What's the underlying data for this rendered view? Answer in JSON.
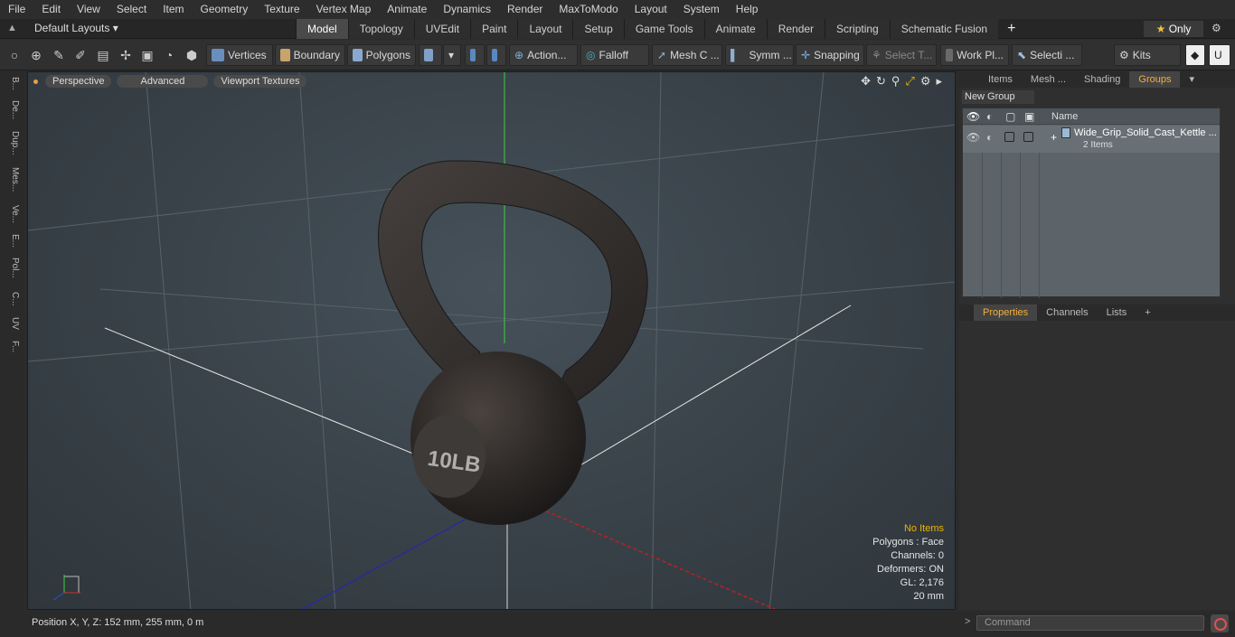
{
  "menu": [
    "File",
    "Edit",
    "View",
    "Select",
    "Item",
    "Geometry",
    "Texture",
    "Vertex Map",
    "Animate",
    "Dynamics",
    "Render",
    "MaxToModo",
    "Layout",
    "System",
    "Help"
  ],
  "layout": {
    "selector": "Default Layouts ▾",
    "tabs": [
      "Model",
      "Topology",
      "UVEdit",
      "Paint",
      "Layout",
      "Setup",
      "Game Tools",
      "Animate",
      "Render",
      "Scripting",
      "Schematic Fusion"
    ],
    "active_tab": "Model",
    "only_label": "Only"
  },
  "toolbar": {
    "vertices": "Vertices",
    "boundary": "Boundary",
    "polygons": "Polygons",
    "action": "Action",
    "falloff": "Falloff",
    "mesh": "Mesh C ...",
    "symm": "Symm ...",
    "snapping": "Snapping",
    "select_t": "Select T...",
    "workpl": "Work Pl...",
    "selecti": "Selecti ...",
    "kits": "Kits"
  },
  "left_tabs": [
    "B...",
    "De...",
    "Dup...",
    "Mes...",
    "Ve...",
    "E...",
    "Pol...",
    "C...",
    "UV",
    "F..."
  ],
  "viewport": {
    "mode": "Perspective",
    "shading": "Advanced",
    "textures": "Viewport Textures",
    "stats": {
      "items": "No Items",
      "polygons": "Polygons : Face",
      "channels": "Channels: 0",
      "deformers": "Deformers: ON",
      "gl": "GL: 2,176",
      "scale": "20 mm"
    }
  },
  "status": "Position X, Y, Z:   152 mm, 255 mm, 0 m",
  "right_panel": {
    "tabs": [
      "Items",
      "Mesh ...",
      "Shading",
      "Groups"
    ],
    "active_tab": "Groups",
    "new_group": "New Group",
    "col_name": "Name",
    "group_name": "Wide_Grip_Solid_Cast_Kettle ...",
    "group_count": "2 Items",
    "prop_tabs": [
      "Properties",
      "Channels",
      "Lists"
    ],
    "active_prop_tab": "Properties"
  },
  "command": {
    "placeholder": "Command"
  }
}
